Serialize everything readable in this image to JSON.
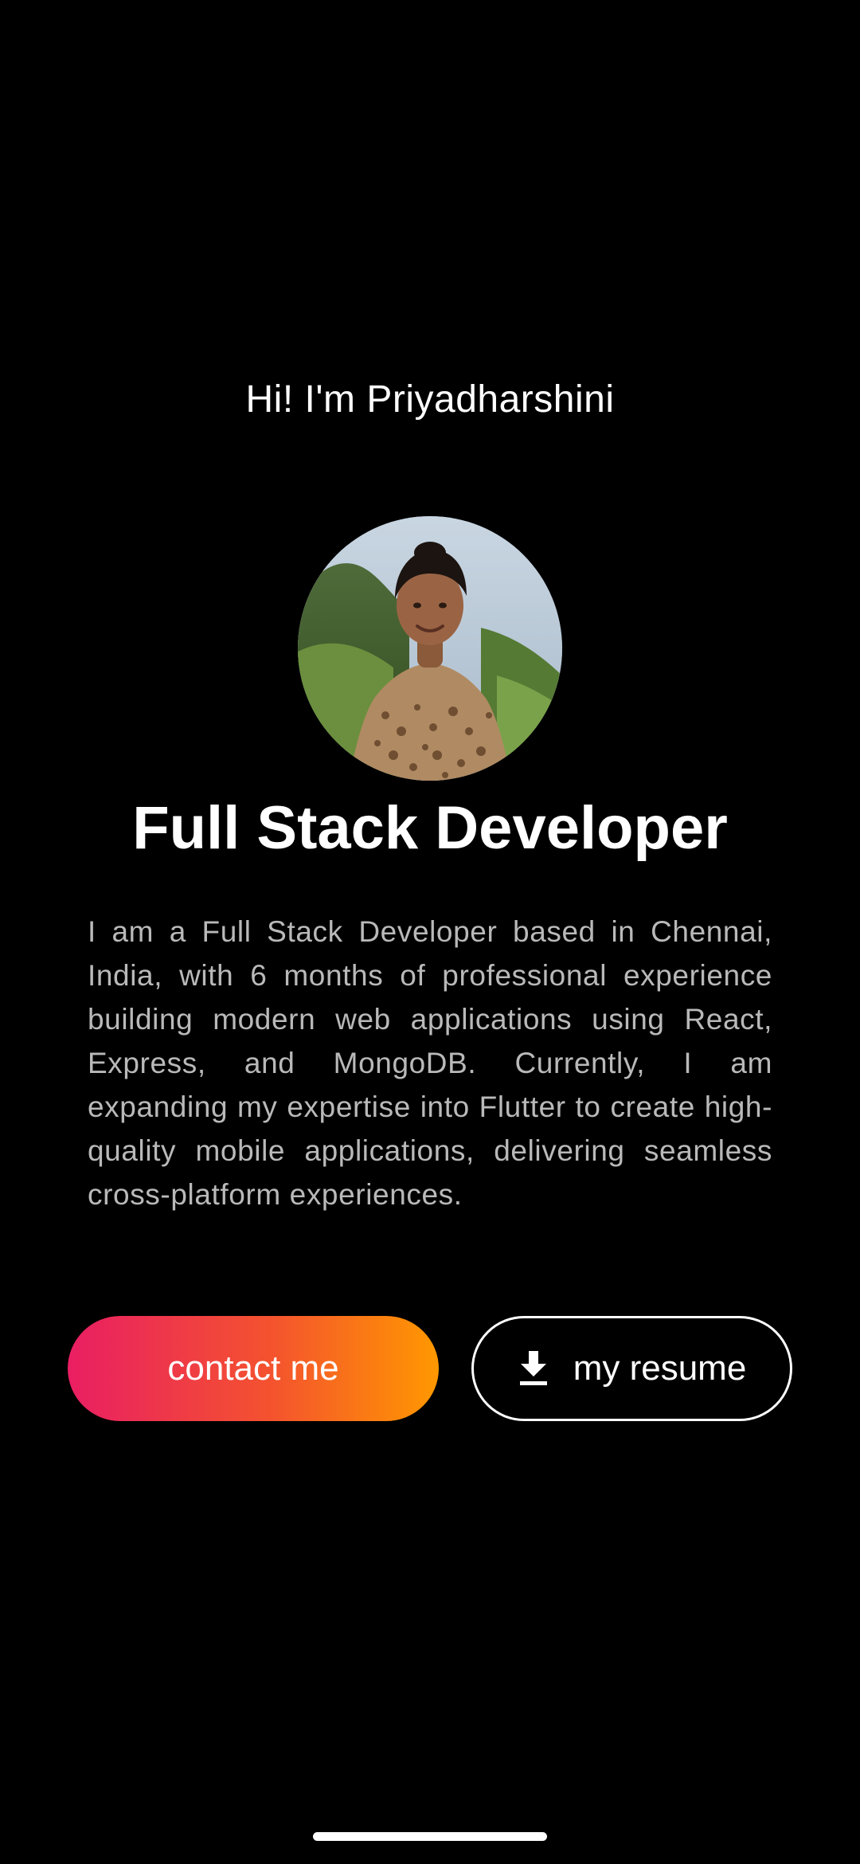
{
  "colors": {
    "background": "#000000",
    "text_primary": "#ffffff",
    "text_secondary": "#b9b9b9",
    "gradient_start": "#e91e63",
    "gradient_end": "#ff9800"
  },
  "hero": {
    "greeting": "Hi! I'm Priyadharshini",
    "role": "Full Stack Developer",
    "bio": "I am a Full Stack Developer based in Chennai, India, with 6 months of professional experience building modern web applications using React, Express, and MongoDB. Currently, I am expanding my expertise into Flutter to create high-quality mobile applications, delivering seamless cross-platform experiences."
  },
  "actions": {
    "contact_label": "contact me",
    "resume_label": "my resume",
    "resume_icon": "download-icon"
  }
}
